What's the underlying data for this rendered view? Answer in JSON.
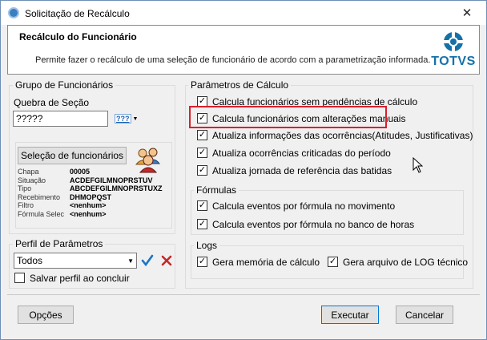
{
  "window": {
    "title": "Solicitação de Recálculo",
    "close_glyph": "✕"
  },
  "header": {
    "title": "Recálculo do Funcionário",
    "description": "Permite fazer o recálculo de uma seleção de funcionário de acordo com a parametrização informada.",
    "logo_text": "TOTVS"
  },
  "grupo": {
    "label": "Grupo de Funcionários",
    "quebra_label": "Quebra de Seção",
    "quebra_value": "?????",
    "lookup_glyph": "???",
    "selecao_button": "Seleção de funcionários",
    "info": [
      {
        "label": "Chapa",
        "value": "00005"
      },
      {
        "label": "Situação",
        "value": "ACDEFGILMNOPRSTUV"
      },
      {
        "label": "Tipo",
        "value": "ABCDEFGILMNOPRSTUXZ"
      },
      {
        "label": "Recebimento",
        "value": "DHMOPQST"
      },
      {
        "label": "Filtro",
        "value": "<nenhum>"
      },
      {
        "label": "Fórmula Selec",
        "value": "<nenhum>"
      }
    ]
  },
  "perfil": {
    "label": "Perfil de Parâmetros",
    "selected": "Todos",
    "salvar_label": "Salvar perfil ao concluir",
    "salvar_checked": false
  },
  "parametros": {
    "label": "Parâmetros de Cálculo",
    "items": [
      {
        "label": "Calcula funcionários sem pendências de cálculo",
        "checked": true
      },
      {
        "label": "Calcula funcionários com alterações manuais",
        "checked": true
      },
      {
        "label": "Atualiza informações das ocorrências(Atitudes, Justificativas)",
        "checked": true
      },
      {
        "label": "Atualiza ocorrências criticadas do período",
        "checked": true
      },
      {
        "label": "Atualiza jornada de referência das batidas",
        "checked": true
      }
    ]
  },
  "formulas": {
    "label": "Fórmulas",
    "items": [
      {
        "label": "Calcula eventos por fórmula no movimento",
        "checked": true
      },
      {
        "label": "Calcula eventos por fórmula no banco de horas",
        "checked": true
      }
    ]
  },
  "logs": {
    "label": "Logs",
    "items": [
      {
        "label": "Gera memória de cálculo",
        "checked": true
      },
      {
        "label": "Gera arquivo de LOG técnico",
        "checked": true
      }
    ]
  },
  "buttons": {
    "opcoes": "Opções",
    "executar": "Executar",
    "cancelar": "Cancelar"
  },
  "colors": {
    "highlight": "#d9202c",
    "confirm": "#1a73c9",
    "cancel": "#c62828",
    "logo": "#1572a9"
  },
  "icons": {
    "confirm": "check-icon",
    "cancel": "x-icon",
    "users": "users-icon",
    "lookup": "lookup-icon",
    "cursor": "mouse-cursor-icon"
  }
}
